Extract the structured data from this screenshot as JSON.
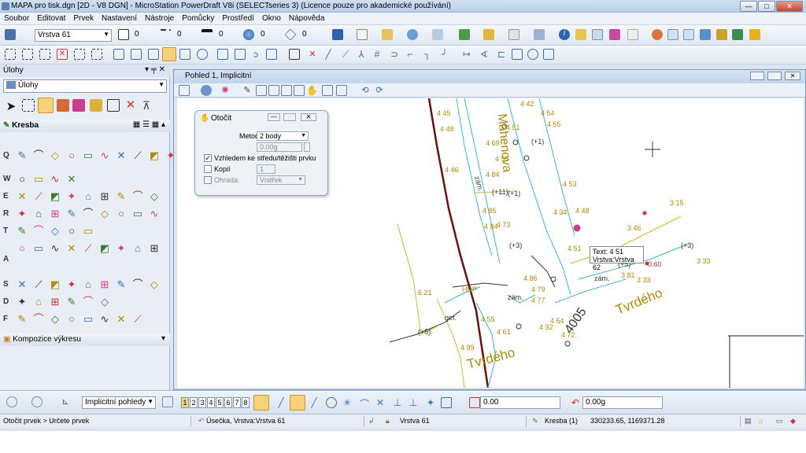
{
  "window": {
    "title": "MAPA pro tisk.dgn [2D - V8 DGN] - MicroStation PowerDraft V8i (SELECTseries 3) (Licence pouze pro akademické používání)"
  },
  "menu": [
    "Soubor",
    "Editovat",
    "Prvek",
    "Nastavení",
    "Nástroje",
    "Pomůcky",
    "Prostředí",
    "Okno",
    "Nápověda"
  ],
  "attributes": {
    "level": "Vrstva 61",
    "color": "0",
    "style": "0",
    "weight": "0",
    "transparency": "0",
    "priority": "0"
  },
  "tasks": {
    "title": "Úlohy",
    "selector": "Úlohy",
    "group": "Kresba",
    "rows": [
      "Q",
      "W",
      "E",
      "R",
      "T",
      "A",
      "S",
      "D",
      "F"
    ],
    "footer": "Kompozice výkresu"
  },
  "view": {
    "title": "Pohled 1, Implicitní"
  },
  "dialog": {
    "title": "Otočit",
    "method_label": "Metoda:",
    "method_value": "2 body",
    "angle_value": "0.00g",
    "about_center_label": "Vzhledem ke středu/těžišti prvku",
    "about_center_checked": true,
    "copies_label": "Kopií",
    "copies_value": "1",
    "clip_label": "Ohrada:",
    "clip_value": "Vnitřek"
  },
  "tooltip": {
    "line1": "Text: 4 51",
    "line2": "Vrstva:Vrstva 62"
  },
  "map_labels": {
    "street1": "Mahenova",
    "street2": "Tvrdého",
    "street3": "Tvrdého",
    "road": "4005",
    "zam1": "zám.",
    "zam2": "zám.",
    "zam3": "zám.",
    "hup": "HUP",
    "gef": "gef.",
    "n1": "4 42",
    "n2": "4 54",
    "n3": "4 55",
    "n4": "4 51",
    "n5": "(+1)",
    "n6": "4 53",
    "n7": "4 48",
    "n8": "4 34",
    "n9": "4 69",
    "n10": "4 55",
    "n11": "4 84",
    "n12": "(+11)",
    "n13": "4 85",
    "n14": "4 73",
    "n15": "4 84",
    "n16": "4 86",
    "n17": "4 79",
    "n18": "4 77",
    "n19": "(+3)",
    "n20": "4 51",
    "n21": "3 15",
    "n22": "(+3)",
    "n23": "0.60",
    "n24": "(+5)",
    "n25": "3 81",
    "n26": "3 33",
    "n27": "4 72",
    "n28": "4 54",
    "n29": "3 33",
    "n30": "(+5)",
    "n31": "4 45",
    "n32": "4 48",
    "n33": "4 46",
    "n34": "(+1)",
    "n35": "6.21",
    "n36": "4 99",
    "n37": "4 55",
    "n38": "4 92",
    "n39": "4 61",
    "n40": "3 46"
  },
  "bottom": {
    "views_combo": "Implicitní pohledy",
    "view_numbers": [
      "1",
      "2",
      "3",
      "4",
      "5",
      "6",
      "7",
      "8"
    ],
    "field1": "0.00",
    "field2": "0.00g"
  },
  "status": {
    "prompt": "Otočit prvek > Určete prvek",
    "element": "Úsečka, Vrstva:Vrstva 61",
    "level": "Vrstva 61",
    "model": "Kresba (1)",
    "coords": "330233.65, 1169371.28"
  },
  "colors": {
    "map_text": "#b08a00",
    "map_line_cyan": "#3cb7c9",
    "map_line_yellow": "#c9b830",
    "map_red": "#8b1a1a"
  }
}
